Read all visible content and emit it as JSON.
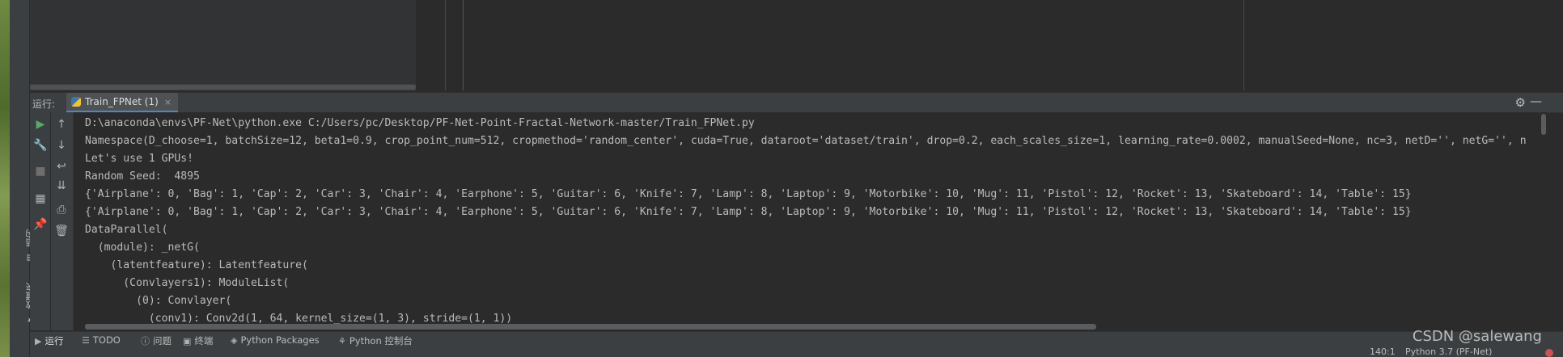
{
  "left_bar": {
    "structure_label": "结构",
    "favorites_label": "收藏夹"
  },
  "run_panel": {
    "label": "运行:",
    "tab_title": "Train_FPNet (1)",
    "tab_close": "×"
  },
  "icons": {
    "settings": "gear-icon",
    "minimize": "minimize-icon",
    "run": "play-icon",
    "wrench": "wrench-icon",
    "stop": "stop-icon",
    "layout": "layout-icon",
    "pin": "pin-icon",
    "up": "arrow-up-icon",
    "down": "arrow-down-icon",
    "wrap": "soft-wrap-icon",
    "scroll_end": "scroll-to-end-icon",
    "print": "print-icon",
    "delete": "trash-icon"
  },
  "console": {
    "lines": [
      "D:\\anaconda\\envs\\PF-Net\\python.exe C:/Users/pc/Desktop/PF-Net-Point-Fractal-Network-master/Train_FPNet.py",
      "Namespace(D_choose=1, batchSize=12, beta1=0.9, crop_point_num=512, cropmethod='random_center', cuda=True, dataroot='dataset/train', drop=0.2, each_scales_size=1, learning_rate=0.0002, manualSeed=None, nc=3, netD='', netG='', n",
      "Let's use 1 GPUs!",
      "Random Seed:  4895",
      "{'Airplane': 0, 'Bag': 1, 'Cap': 2, 'Car': 3, 'Chair': 4, 'Earphone': 5, 'Guitar': 6, 'Knife': 7, 'Lamp': 8, 'Laptop': 9, 'Motorbike': 10, 'Mug': 11, 'Pistol': 12, 'Rocket': 13, 'Skateboard': 14, 'Table': 15}",
      "{'Airplane': 0, 'Bag': 1, 'Cap': 2, 'Car': 3, 'Chair': 4, 'Earphone': 5, 'Guitar': 6, 'Knife': 7, 'Lamp': 8, 'Laptop': 9, 'Motorbike': 10, 'Mug': 11, 'Pistol': 12, 'Rocket': 13, 'Skateboard': 14, 'Table': 15}",
      "DataParallel(",
      "  (module): _netG(",
      "    (latentfeature): Latentfeature(",
      "      (Convlayers1): ModuleList(",
      "        (0): Convlayer(",
      "          (conv1): Conv2d(1, 64, kernel_size=(1, 3), stride=(1, 1))"
    ]
  },
  "bottom_tabs": [
    {
      "label": "运行",
      "icon": "play-icon"
    },
    {
      "label": "TODO",
      "icon": "list-icon"
    },
    {
      "label": "问题",
      "icon": "problems-icon"
    },
    {
      "label": "终端",
      "icon": "terminal-icon"
    },
    {
      "label": "Python Packages",
      "icon": "packages-icon"
    },
    {
      "label": "Python 控制台",
      "icon": "python-console-icon"
    }
  ],
  "status_bar": {
    "position": "140:1",
    "interpreter": "Python 3.7 (PF-Net)"
  },
  "watermark": "CSDN @salewang"
}
